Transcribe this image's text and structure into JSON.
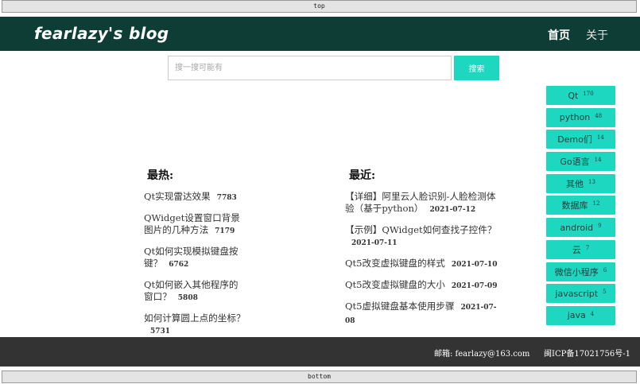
{
  "edges": {
    "top": "top",
    "bottom": "bottom"
  },
  "header": {
    "brand": "fearlazy's blog",
    "nav": [
      "首页",
      "关于"
    ]
  },
  "search": {
    "placeholder": "搜一搜可能有",
    "button": "搜索"
  },
  "hot": {
    "title": "最热:",
    "items": [
      {
        "title": "Qt实现雷达效果",
        "count": "7783"
      },
      {
        "title": "QWidget设置窗口背景图片的几种方法",
        "count": "7179"
      },
      {
        "title": "Qt如何实现模拟键盘按键？",
        "count": "6762"
      },
      {
        "title": "Qt如何嵌入其他程序的窗口？",
        "count": "5808"
      },
      {
        "title": "如何计算圆上点的坐标？",
        "count": "5731"
      }
    ]
  },
  "recent": {
    "title": "最近:",
    "items": [
      {
        "title": "【详细】阿里云人脸识别-人脸检测体验（基于python）",
        "date": "2021-07-12"
      },
      {
        "title": "【示例】QWidget如何查找子控件？",
        "date": "2021-07-11"
      },
      {
        "title": "Qt5改变虚拟键盘的样式",
        "date": "2021-07-10"
      },
      {
        "title": "Qt5改变虚拟键盘的大小",
        "date": "2021-07-09"
      },
      {
        "title": "Qt5虚拟键盘基本使用步骤",
        "date": "2021-07-08"
      }
    ]
  },
  "tags": [
    {
      "name": "Qt",
      "count": "170"
    },
    {
      "name": "python",
      "count": "48"
    },
    {
      "name": "Demo们",
      "count": "14"
    },
    {
      "name": "Go语言",
      "count": "14"
    },
    {
      "name": "其他",
      "count": "13"
    },
    {
      "name": "数据库",
      "count": "12"
    },
    {
      "name": "android",
      "count": "9"
    },
    {
      "name": "云",
      "count": "7"
    },
    {
      "name": "微信小程序",
      "count": "6"
    },
    {
      "name": "javascript",
      "count": "5"
    },
    {
      "name": "java",
      "count": "4"
    }
  ],
  "footer": {
    "mail": "邮箱: fearlazy@163.com",
    "icp": "闽ICP备17021756号-1"
  }
}
